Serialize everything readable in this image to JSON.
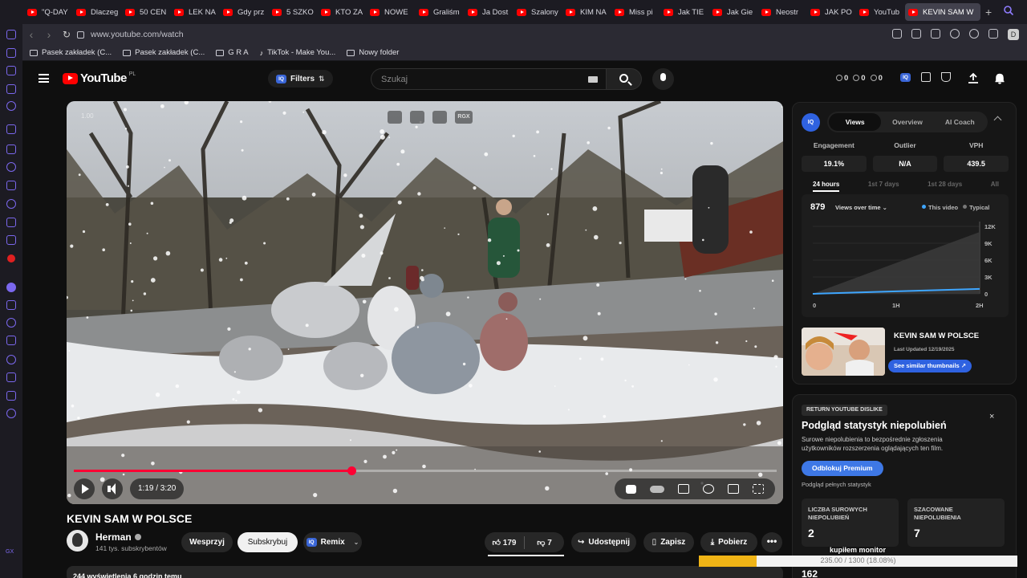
{
  "browser": {
    "tabs": [
      {
        "label": "\"Q-DAY"
      },
      {
        "label": "Dlaczeg"
      },
      {
        "label": "50 CEN"
      },
      {
        "label": "LEK NA"
      },
      {
        "label": "Gdy prz"
      },
      {
        "label": "5 SZKO"
      },
      {
        "label": "KTO ZA"
      },
      {
        "label": "NOWE"
      },
      {
        "label": "Graliśm"
      },
      {
        "label": "Ja Dost"
      },
      {
        "label": "Szalony"
      },
      {
        "label": "KIM NA"
      },
      {
        "label": "Miss pi"
      },
      {
        "label": "Jak TIE"
      },
      {
        "label": "Jak Gie"
      },
      {
        "label": "Neostr"
      },
      {
        "label": "JAK PO"
      },
      {
        "label": "YouTub"
      }
    ],
    "active_tab": "KEVIN SAM W",
    "new_tab": "+",
    "url": "www.youtube.com/watch",
    "bookmarks": [
      "Pasek zakładek (C...",
      "Pasek zakładek (C...",
      "G R A",
      "TikTok - Make You...",
      "Nowy folder"
    ],
    "sidebar_footer": "GX"
  },
  "header": {
    "logo_text": "YouTube",
    "country": "PL",
    "filters_label": "Filters",
    "iq_badge": "IQ",
    "search_placeholder": "Szukaj",
    "stats": [
      "0",
      "0",
      "0"
    ]
  },
  "player": {
    "watermark": "1.00",
    "overlay_button": "RGX",
    "time": "1:19 / 3:20",
    "progress": 0.395
  },
  "video": {
    "title": "KEVIN SAM W POLSCE",
    "channel": "Herman",
    "subscribers": "141 tys. subskrybentów",
    "support": "Wesprzyj",
    "subscribe": "Subskrybuj",
    "remix": "Remix",
    "likes": "179",
    "dislikes": "7",
    "share": "Udostępnij",
    "save": "Zapisz",
    "download": "Pobierz",
    "more": "•••",
    "description_preview": "244 wyświetlenia  6 godzin temu"
  },
  "vidiq": {
    "logo": "IQ",
    "tabs": [
      "Views",
      "Overview",
      "AI Coach"
    ],
    "active_tab": "Views",
    "metrics": [
      {
        "label": "Engagement",
        "value": "19.1%"
      },
      {
        "label": "Outlier",
        "value": "N/A"
      },
      {
        "label": "VPH",
        "value": "439.5"
      }
    ],
    "ranges": [
      "24 hours",
      "1st 7 days",
      "1st 28 days",
      "All"
    ],
    "active_range": "24 hours",
    "views_count": "879",
    "views_selector": "Views over time",
    "legend": [
      {
        "name": "This video",
        "color": "#3ea6ff"
      },
      {
        "name": "Typical",
        "color": "#777777"
      }
    ],
    "card_title": "KEVIN SAM W POLSCE",
    "card_updated": "Last Updated 12/19/2025",
    "card_button": "See similar thumbnails ↗"
  },
  "chart_data": {
    "type": "area",
    "x_ticks": [
      "0",
      "1H",
      "2H"
    ],
    "y_ticks": [
      "12K",
      "9K",
      "6K",
      "3K",
      "0"
    ],
    "ylim": [
      0,
      12000
    ],
    "series": [
      {
        "name": "This video",
        "color": "#3ea6ff",
        "x": [
          0,
          1,
          2
        ],
        "values": [
          0,
          440,
          880
        ]
      },
      {
        "name": "Typical",
        "color": "#777777",
        "x": [
          0,
          1,
          2
        ],
        "values": [
          0,
          5500,
          11000
        ]
      }
    ]
  },
  "ryd": {
    "tag": "RETURN YOUTUBE DISLIKE",
    "close": "×",
    "title": "Podgląd statystyk niepolubień",
    "text": "Surowe niepolubienia to bezpośrednie zgłoszenia użytkowników rozszerzenia oglądających ten film.",
    "button": "Odblokuj Premium",
    "note": "Podgląd pełnych statystyk",
    "boxes": [
      {
        "label": "LICZBA SUROWYCH NIEPOLUBIEŃ",
        "value": "2"
      },
      {
        "label": "SZACOWANE NIEPOLUBIENIA",
        "value": "7"
      }
    ],
    "bottom_value": "162"
  },
  "overlay": {
    "label": "kupiłem monitor",
    "progress_text": "235.00 / 1300 (18.08%)",
    "progress": 0.1808
  },
  "colors": {
    "youtube_red": "#ff0000",
    "progress_red": "#ff0033",
    "vidiq_blue": "#2f62e0",
    "accent_purple": "#7b68ee",
    "overlay_gold": "#f0b416"
  }
}
